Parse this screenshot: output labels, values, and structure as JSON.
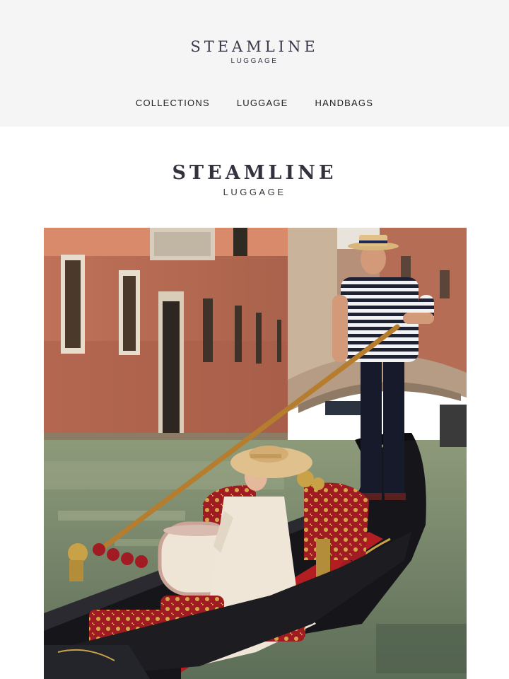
{
  "header": {
    "brand": "STEAMLINE",
    "brand_sub": "LUGGAGE"
  },
  "nav": {
    "items": [
      {
        "label": "COLLECTIONS"
      },
      {
        "label": "LUGGAGE"
      },
      {
        "label": "HANDBAGS"
      }
    ]
  },
  "hero_brand": {
    "brand": "STEAMLINE",
    "brand_sub": "LUGGAGE"
  },
  "hero": {
    "colors": {
      "brick": "#b4654d",
      "water": "#7a8a6a",
      "gondola": "#1a1a1e",
      "velvet_red": "#a51f24",
      "gold": "#c9a247"
    }
  }
}
